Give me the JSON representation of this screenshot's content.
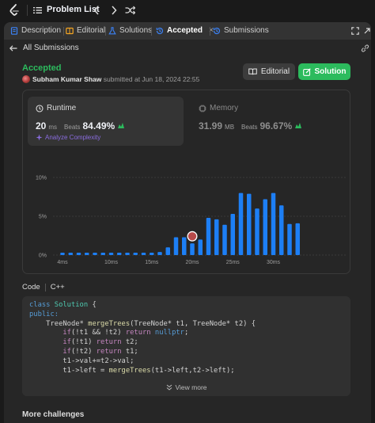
{
  "topbar": {
    "title": "Problem List"
  },
  "tabs": [
    {
      "label": "Description",
      "icon": "document-icon",
      "color": "#3b82f6"
    },
    {
      "label": "Editorial",
      "icon": "book-icon",
      "color": "#f5a623"
    },
    {
      "label": "Solutions",
      "icon": "flask-icon",
      "color": "#3b82f6"
    },
    {
      "label": "Accepted",
      "icon": "history-icon",
      "color": "#3b82f6",
      "active": true,
      "close": "×"
    },
    {
      "label": "Submissions",
      "icon": "history-icon",
      "color": "#3b82f6"
    }
  ],
  "back_label": "All Submissions",
  "status": "Accepted",
  "author": "Subham Kumar Shaw",
  "submitted_text": "submitted at Jun 18, 2024 22:55",
  "buttons": {
    "editorial": "Editorial",
    "solution": "Solution"
  },
  "runtime": {
    "title": "Runtime",
    "value": "20",
    "unit": "ms",
    "beats_label": "Beats",
    "beats": "84.49%",
    "analyze": "Analyze Complexity"
  },
  "memory": {
    "title": "Memory",
    "value": "31.99",
    "unit": "MB",
    "beats_label": "Beats",
    "beats": "96.67%"
  },
  "chart_data": {
    "type": "bar",
    "x_unit": "ms",
    "x": [
      4,
      5,
      6,
      7,
      8,
      9,
      10,
      11,
      12,
      13,
      14,
      15,
      16,
      17,
      18,
      19,
      20,
      21,
      22,
      23,
      24,
      25,
      26,
      27,
      28,
      29,
      30,
      31,
      32,
      33
    ],
    "values": [
      0.3,
      0.3,
      0.3,
      0.3,
      0.3,
      0.3,
      0.3,
      0.3,
      0.3,
      0.3,
      0.3,
      0.3,
      0.4,
      1.0,
      2.3,
      2.3,
      1.5,
      2.0,
      4.8,
      4.6,
      3.9,
      5.3,
      8.0,
      7.9,
      6.0,
      7.2,
      8.0,
      6.4,
      4.0,
      4.1
    ],
    "yticks": [
      "0%",
      "5%",
      "10%"
    ],
    "ylim": [
      0,
      10
    ],
    "xticks": [
      "4ms",
      "10ms",
      "15ms",
      "20ms",
      "25ms",
      "30ms"
    ],
    "xtick_values": [
      4,
      10,
      15,
      20,
      25,
      30
    ],
    "bar_color": "#1d7ff5",
    "highlight_x": 20,
    "brush_xticks": [
      "4ms",
      "10ms",
      "15ms",
      "20ms",
      "25ms",
      "30ms"
    ]
  },
  "code": {
    "label": "Code",
    "language": "C++",
    "view_more": "View more",
    "lines": [
      [
        {
          "t": "class ",
          "c": "kw"
        },
        {
          "t": "Solution",
          "c": "ty"
        },
        {
          "t": " {",
          "c": ""
        }
      ],
      [
        {
          "t": "public:",
          "c": "kw"
        }
      ],
      [
        {
          "t": "    TreeNode* ",
          "c": ""
        },
        {
          "t": "mergeTrees",
          "c": "fn"
        },
        {
          "t": "(TreeNode* t1, TreeNode* t2) {",
          "c": ""
        }
      ],
      [
        {
          "t": "        ",
          "c": ""
        },
        {
          "t": "if",
          "c": "kw2"
        },
        {
          "t": "(!t1 && !t2) ",
          "c": ""
        },
        {
          "t": "return",
          "c": "kw2"
        },
        {
          "t": " ",
          "c": ""
        },
        {
          "t": "nullptr",
          "c": "kw"
        },
        {
          "t": ";",
          "c": ""
        }
      ],
      [
        {
          "t": "        ",
          "c": ""
        },
        {
          "t": "if",
          "c": "kw2"
        },
        {
          "t": "(!t1) ",
          "c": ""
        },
        {
          "t": "return",
          "c": "kw2"
        },
        {
          "t": " t2;",
          "c": ""
        }
      ],
      [
        {
          "t": "        ",
          "c": ""
        },
        {
          "t": "if",
          "c": "kw2"
        },
        {
          "t": "(!t2) ",
          "c": ""
        },
        {
          "t": "return",
          "c": "kw2"
        },
        {
          "t": " t1;",
          "c": ""
        }
      ],
      [
        {
          "t": "        t1->val+=t2->val;",
          "c": ""
        }
      ],
      [
        {
          "t": "        t1->left = ",
          "c": ""
        },
        {
          "t": "mergeTrees",
          "c": "fn"
        },
        {
          "t": "(t1->left,t2->left);",
          "c": ""
        }
      ]
    ]
  },
  "more_challenges": "More challenges"
}
